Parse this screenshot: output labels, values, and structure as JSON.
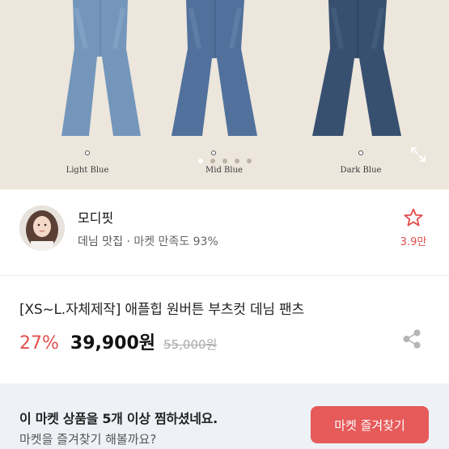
{
  "hero": {
    "variants": [
      {
        "label": "Light Blue",
        "color": "#6f93b8"
      },
      {
        "label": "Mid Blue",
        "color": "#4f6f9a"
      },
      {
        "label": "Dark Blue",
        "color": "#37506f"
      }
    ],
    "page_count": 5,
    "active_page": 1,
    "background": "#ece6dc"
  },
  "seller": {
    "name": "모디핏",
    "category": "데님 맛집",
    "separator": "·",
    "satisfaction": "마켓 만족도 93%",
    "favorite_count": "3.9만"
  },
  "product": {
    "title": "[XS~L.자체제작] 애플힙 원버튼 부츠컷 데님 팬츠",
    "discount": "27%",
    "price": "39,900원",
    "original_price": "55,000원"
  },
  "banner": {
    "line1": "이 마켓 상품을 5개 이상 찜하셨네요.",
    "line2": "마켓을 즐겨찾기 해볼까요?",
    "button_label": "마켓 즐겨찾기",
    "accent": "#e65a5a"
  }
}
